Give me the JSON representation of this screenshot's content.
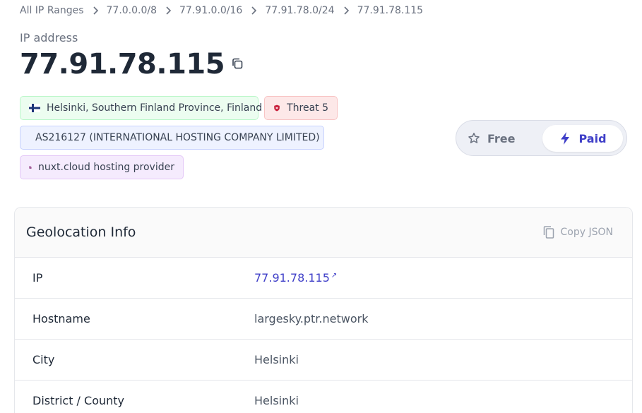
{
  "breadcrumb": [
    "All IP Ranges",
    "77.0.0.0/8",
    "77.91.0.0/16",
    "77.91.78.0/24",
    "77.91.78.115"
  ],
  "header": {
    "label": "IP address",
    "ip": "77.91.78.115"
  },
  "tags": {
    "location": "Helsinki, Southern Finland Province, Finland",
    "threat": "Threat 5",
    "asn": "AS216127 (INTERNATIONAL HOSTING COMPANY LIMITED)",
    "hosting": "nuxt.cloud hosting provider"
  },
  "plan": {
    "free_label": "Free",
    "paid_label": "Paid",
    "selected": "Paid"
  },
  "geolocation": {
    "title": "Geolocation Info",
    "copy_label": "Copy JSON",
    "rows": [
      {
        "key": "IP",
        "value": "77.91.78.115"
      },
      {
        "key": "Hostname",
        "value": "largesky.ptr.network"
      },
      {
        "key": "City",
        "value": "Helsinki"
      },
      {
        "key": "District / County",
        "value": "Helsinki"
      }
    ]
  },
  "colors": {
    "accent": "#3f3fc8",
    "threat": "#c81e3a",
    "hosting": "#7e1f6e"
  },
  "icons": {
    "flag": "finland-flag-icon",
    "threat": "shield-icon",
    "asn": "globe-icon",
    "hosting": "building-icon",
    "free": "star-icon",
    "paid": "lightning-icon",
    "copy": "copy-icon",
    "external": "external-link-icon"
  }
}
